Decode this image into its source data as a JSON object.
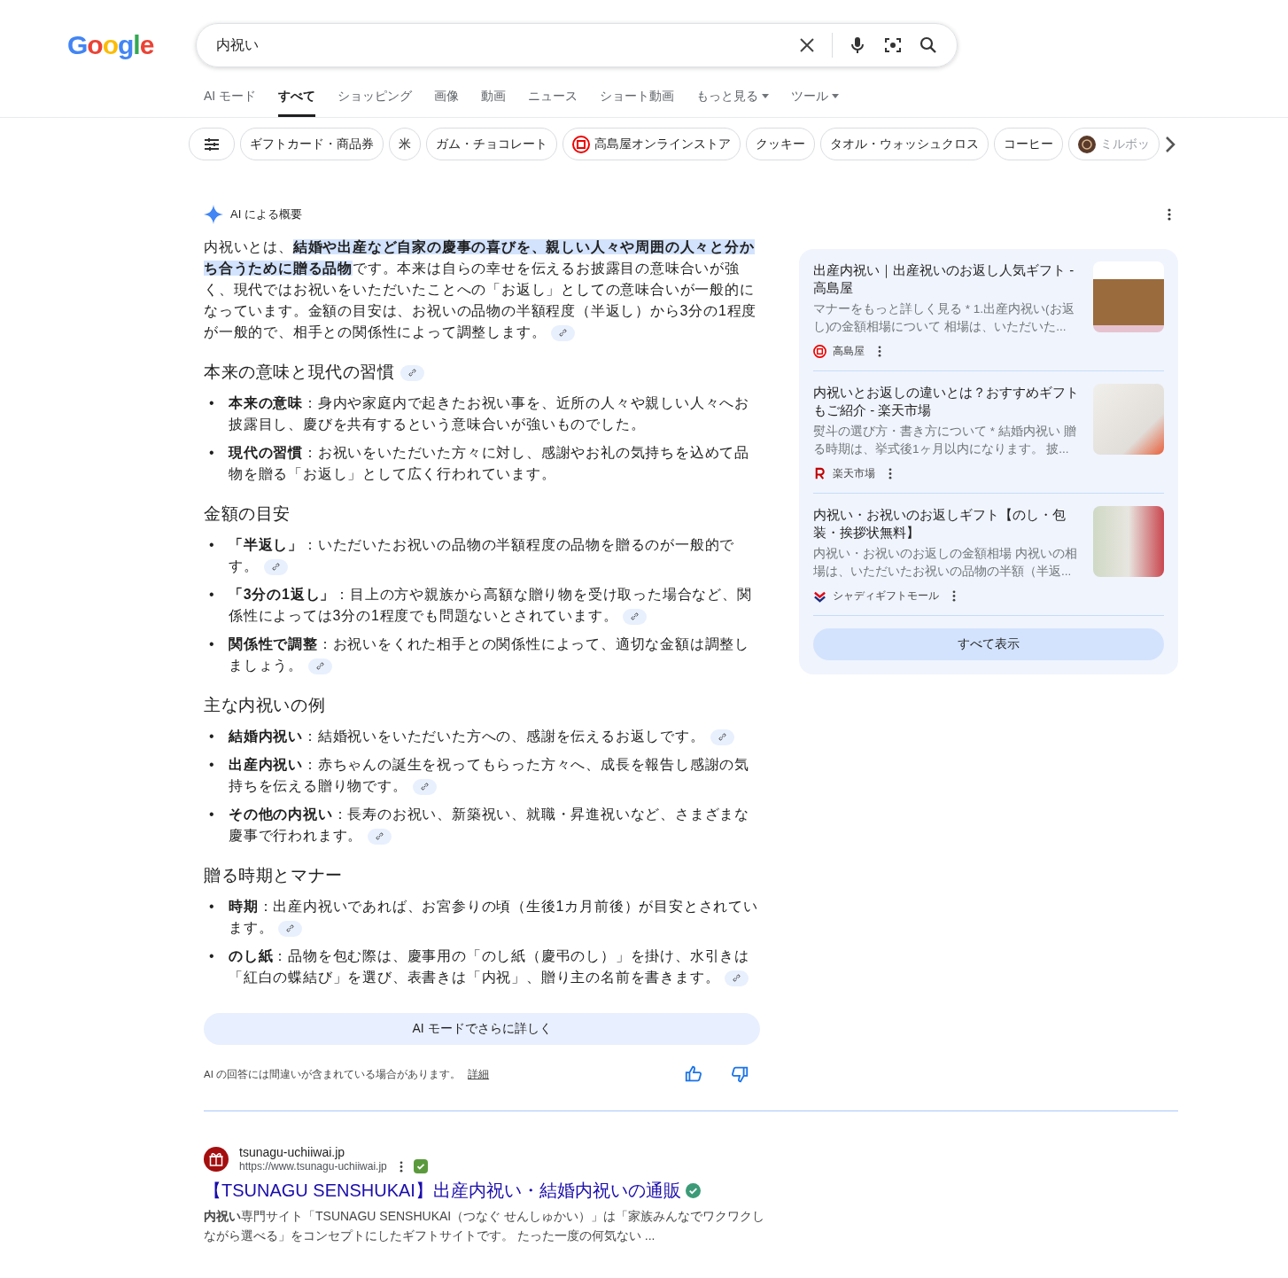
{
  "logo": "Google",
  "search": {
    "value": "内祝い"
  },
  "tabs": [
    {
      "label": "AI モード",
      "selected": false,
      "dropdown": false
    },
    {
      "label": "すべて",
      "selected": true,
      "dropdown": false
    },
    {
      "label": "ショッピング",
      "selected": false,
      "dropdown": false
    },
    {
      "label": "画像",
      "selected": false,
      "dropdown": false
    },
    {
      "label": "動画",
      "selected": false,
      "dropdown": false
    },
    {
      "label": "ニュース",
      "selected": false,
      "dropdown": false
    },
    {
      "label": "ショート動画",
      "selected": false,
      "dropdown": false
    },
    {
      "label": "もっと見る",
      "selected": false,
      "dropdown": true
    },
    {
      "label": "ツール",
      "selected": false,
      "dropdown": true
    }
  ],
  "chips": [
    {
      "label": "ギフトカード・商品券",
      "kind": "text"
    },
    {
      "label": "米",
      "kind": "text"
    },
    {
      "label": "ガム・チョコレート",
      "kind": "text"
    },
    {
      "label": "高島屋オンラインストア",
      "kind": "logo"
    },
    {
      "label": "クッキー",
      "kind": "text"
    },
    {
      "label": "タオル・ウォッシュクロス",
      "kind": "text"
    },
    {
      "label": "コーヒー",
      "kind": "text"
    },
    {
      "label": "ミルボッ",
      "kind": "photo"
    }
  ],
  "ai_overview": {
    "label": "AI による概要",
    "intro": [
      {
        "text": "内祝いとは、",
        "highlighted": false
      },
      {
        "text": "結婚や出産など自家の慶事の喜びを、親しい人々や周囲の人々と分かち合うために贈る品物",
        "highlighted": true
      },
      {
        "text": "です。本来は自らの幸せを伝えるお披露目の意味合いが強く、現代ではお祝いをいただいたことへの「お返し」としての意味合いが一般的になっています。金額の目安は、お祝いの品物の半額程度（半返し）から3分の1程度が一般的で、相手との関係性によって調整します。",
        "highlighted": false
      }
    ],
    "intro_citation": true,
    "sections": [
      {
        "heading": "本来の意味と現代の習慣",
        "citation": true,
        "marker": "•",
        "bullets": [
          {
            "text": "**本来の意味**：身内や家庭内で起きたお祝い事を、近所の人々や親しい人々へお披露目し、慶びを共有するという意味合いが強いものでした。",
            "citation": false
          },
          {
            "text": "**現代の習慣**：お祝いをいただいた方々に対し、感謝やお礼の気持ちを込めて品物を贈る「お返し」として広く行われています。",
            "citation": false
          }
        ]
      },
      {
        "heading": "金額の目安",
        "citation": false,
        "marker": "•",
        "bullets": [
          {
            "text": "**「半返し」**：いただいたお祝いの品物の半額程度の品物を贈るのが一般的です。",
            "citation": true
          },
          {
            "text": "**「3分の1返し」**：目上の方や親族から高額な贈り物を受け取った場合など、関係性によっては3分の1程度でも問題ないとされています。",
            "citation": true
          },
          {
            "text": "**関係性で調整**：お祝いをくれた相手との関係性によって、適切な金額は調整しましょう。",
            "citation": true
          }
        ]
      },
      {
        "heading": "主な内祝いの例",
        "citation": false,
        "marker": "•",
        "bullets": [
          {
            "text": "**結婚内祝い**：結婚祝いをいただいた方への、感謝を伝えるお返しです。",
            "citation": true
          },
          {
            "text": "**出産内祝い**：赤ちゃんの誕生を祝ってもらった方々へ、成長を報告し感謝の気持ちを伝える贈り物です。",
            "citation": true
          },
          {
            "text": "**その他の内祝い**：長寿のお祝い、新築祝い、就職・昇進祝いなど、さまざまな慶事で行われます。",
            "citation": true
          }
        ]
      },
      {
        "heading": "贈る時期とマナー",
        "citation": false,
        "marker": "•",
        "bullets": [
          {
            "text": "**時期**：出産内祝いであれば、お宮参りの頃（生後1カ月前後）が目安とされています。",
            "citation": true
          },
          {
            "text": "**のし紙**：品物を包む際は、慶事用の「のし紙（慶弔のし）」を掛け、水引きは「紅白の蝶結び」を選び、表書きは「内祝」、贈り主の名前を書きます。",
            "citation": true
          }
        ]
      }
    ],
    "more_button": "AI モードでさらに詳しく",
    "disclaimer": "AI の回答には間違いが含まれている場合があります。",
    "details_link": "詳細",
    "sources": [
      {
        "title": "出産内祝い｜出産祝いのお返し人気ギフト - 高島屋",
        "snippet": "マナーをもっと詳しく見る * 1.出産内祝い(お返し)の金額相場について 相場は、いただいた...",
        "source": "高島屋"
      },
      {
        "title": "内祝いとお返しの違いとは？おすすめギフトもご紹介 - 楽天市場",
        "snippet": "熨斗の選び方・書き方について * 結婚内祝い 贈る時期は、挙式後1ヶ月以内になります。 披...",
        "source": "楽天市場"
      },
      {
        "title": "内祝い・お祝いのお返しギフト【のし・包装・挨拶状無料】",
        "snippet": "内祝い・お祝いのお返しの金額相場 内祝いの相場は、いただいたお祝いの品物の半額（半返...",
        "source": "シャディギフトモール"
      }
    ],
    "show_all": "すべて表示"
  },
  "results": [
    {
      "site": "tsunagu-uchiiwai.jp",
      "url": "https://www.tsunagu-uchiiwai.jp",
      "verified": true,
      "title": "【TSUNAGU SENSHUKAI】出産内祝い・結婚内祝いの通販",
      "snippet": "**内祝い**専門サイト「TSUNAGU SENSHUKAI（つなぐ せんしゅかい）」は「家族みんなでワクワクしながら選べる」をコンセプトにしたギフトサイトです。 たった一度の何気ない ..."
    }
  ]
}
